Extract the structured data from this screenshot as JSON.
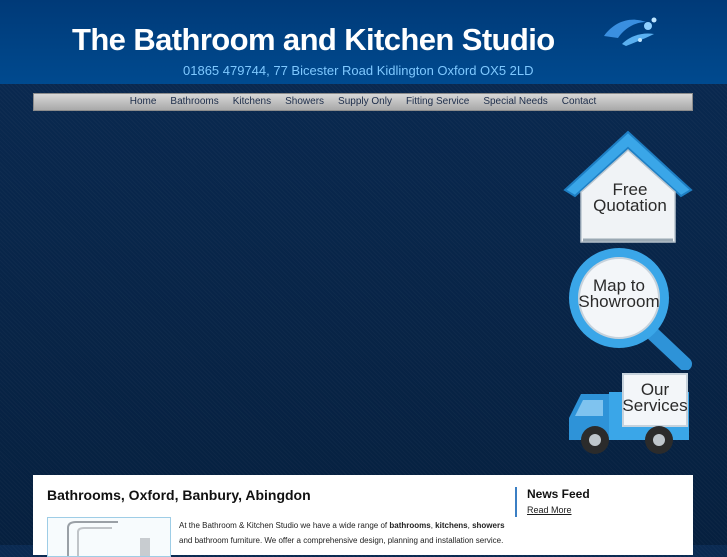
{
  "header": {
    "title": "The Bathroom and Kitchen Studio",
    "address": "01865 479744,  77 Bicester Road  Kidlington  Oxford OX5 2LD"
  },
  "nav": {
    "items": [
      "Home",
      "Bathrooms",
      "Kitchens",
      "Showers",
      "Supply Only",
      "Fitting Service",
      "Special Needs",
      "Contact"
    ]
  },
  "side_buttons": {
    "quote": {
      "line1": "Free",
      "line2": "Quotation"
    },
    "map": {
      "line1": "Map to",
      "line2": "Showroom"
    },
    "services": {
      "line1": "Our",
      "line2": "Services"
    }
  },
  "main": {
    "heading": "Bathrooms, Oxford, Banbury, Abingdon",
    "intro": {
      "part1": "At the Bathroom & Kitchen Studio we have a wide range of ",
      "bold1": "bathrooms",
      "sep1": ", ",
      "bold2": "kitchens",
      "sep2": ", ",
      "bold3": "showers",
      "part2": " and bathroom furniture. We offer a comprehensive design, planning and installation service."
    }
  },
  "news": {
    "title": "News Feed",
    "read_more": "Read More"
  },
  "colors": {
    "header_bg": "#003a78",
    "page_bg": "#07203f",
    "address_text": "#7ec8ff",
    "button_blue": "#3aa6e8"
  },
  "icons": [
    "house-icon",
    "magnifier-icon",
    "van-icon",
    "water-splash-icon"
  ]
}
